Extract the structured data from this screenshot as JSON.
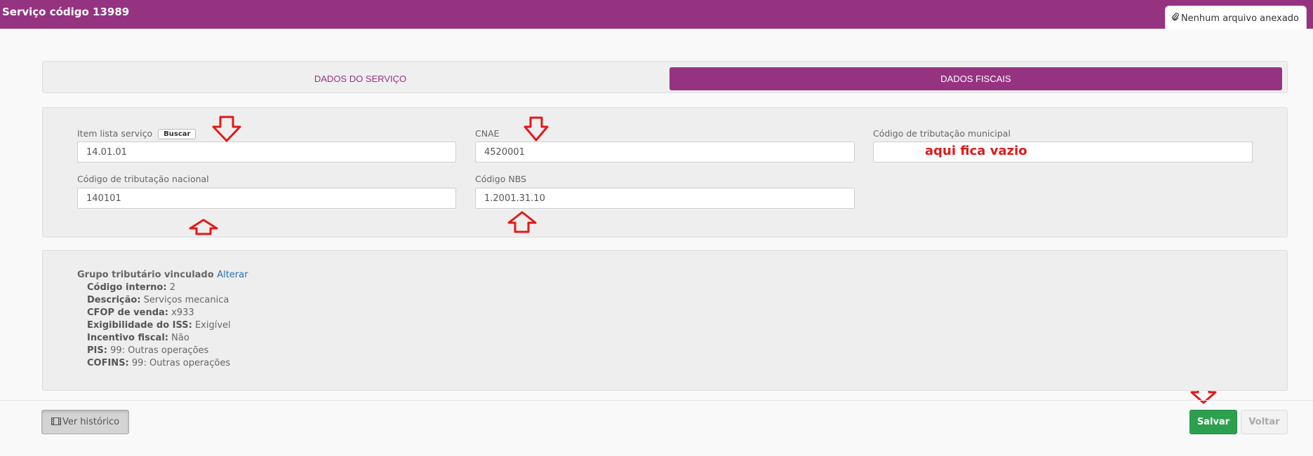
{
  "header": {
    "title": "Serviço código 13989",
    "attachment": "Nenhum arquivo anexado",
    "attachment_icon": "paperclip-icon"
  },
  "tabs": [
    {
      "label": "DADOS DO SERVIÇO",
      "active": false
    },
    {
      "label": "DADOS FISCAIS",
      "active": true
    }
  ],
  "fields": {
    "item_lista": {
      "label": "Item lista serviço",
      "button": "Buscar",
      "value": "14.01.01"
    },
    "cnae": {
      "label": "CNAE",
      "value": "4520001"
    },
    "codigo_municipal": {
      "label": "Código de tributação municipal",
      "value": ""
    },
    "codigo_nacional": {
      "label": "Código de tributação nacional",
      "value": "140101"
    },
    "codigo_nbs": {
      "label": "Código NBS",
      "value": "1.2001.31.10"
    }
  },
  "annotation": {
    "text": "aqui fica vazio",
    "color": "#e01a1a"
  },
  "grupo": {
    "title": "Grupo tributário vinculado",
    "link": "Alterar",
    "rows": [
      {
        "key": "Código interno:",
        "value": "2"
      },
      {
        "key": "Descrição:",
        "value": "Serviços mecanica"
      },
      {
        "key": "CFOP de venda:",
        "value": "x933"
      },
      {
        "key": "Exigibilidade do ISS:",
        "value": "Exigível"
      },
      {
        "key": "Incentivo fiscal:",
        "value": "Não"
      },
      {
        "key": "PIS:",
        "value": "99: Outras operações"
      },
      {
        "key": "COFINS:",
        "value": "99: Outras operações"
      }
    ]
  },
  "footer": {
    "history_label": "Ver histórico",
    "history_icon": "film-icon",
    "save_label": "Salvar",
    "back_label": "Voltar"
  },
  "colors": {
    "brand": "#963381",
    "save": "#2da050",
    "link": "#2a6fb0"
  }
}
